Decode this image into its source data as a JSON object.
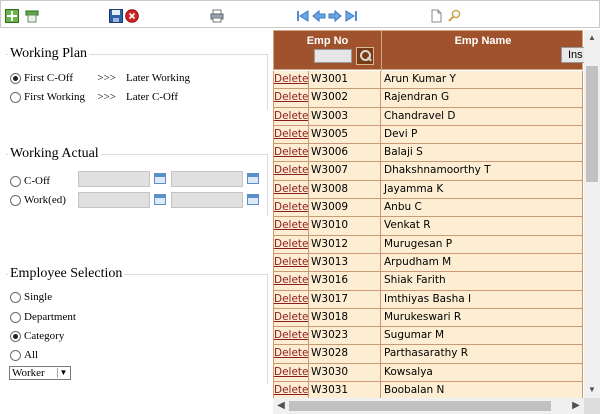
{
  "toolbar": {
    "icons": [
      "add-icon",
      "grid-icon",
      "save-icon",
      "delete-icon",
      "print-icon",
      "first-icon",
      "prev-icon",
      "next-icon",
      "last-icon",
      "new-document-icon",
      "search-icon"
    ]
  },
  "working_plan": {
    "legend": "Working Plan",
    "options": [
      {
        "left": "First C-Off",
        "sep": ">>>",
        "right": "Later Working",
        "selected": true
      },
      {
        "left": "First Working",
        "sep": ">>>",
        "right": "Later C-Off",
        "selected": false
      }
    ]
  },
  "working_actual": {
    "legend": "Working Actual",
    "options": [
      {
        "label": "C-Off",
        "selected": false
      },
      {
        "label": "Work(ed)",
        "selected": false
      }
    ]
  },
  "employee_selection": {
    "legend": "Employee Selection",
    "options": [
      {
        "label": "Single",
        "selected": false
      },
      {
        "label": "Department",
        "selected": false
      },
      {
        "label": "Category",
        "selected": true
      },
      {
        "label": "All",
        "selected": false
      }
    ],
    "category_select": {
      "value": "Worker"
    }
  },
  "grid": {
    "columns": {
      "emp_no": "Emp No",
      "emp_name": "Emp Name"
    },
    "insert_label": "Ins",
    "delete_label": "Delete",
    "rows": [
      {
        "emp_no": "W3001",
        "emp_name": "Arun Kumar Y"
      },
      {
        "emp_no": "W3002",
        "emp_name": "Rajendran G"
      },
      {
        "emp_no": "W3003",
        "emp_name": "Chandravel D"
      },
      {
        "emp_no": "W3005",
        "emp_name": "Devi P"
      },
      {
        "emp_no": "W3006",
        "emp_name": "Balaji S"
      },
      {
        "emp_no": "W3007",
        "emp_name": "Dhakshnamoorthy T"
      },
      {
        "emp_no": "W3008",
        "emp_name": "Jayamma K"
      },
      {
        "emp_no": "W3009",
        "emp_name": "Anbu C"
      },
      {
        "emp_no": "W3010",
        "emp_name": "Venkat R"
      },
      {
        "emp_no": "W3012",
        "emp_name": "Murugesan P"
      },
      {
        "emp_no": "W3013",
        "emp_name": "Arpudham M"
      },
      {
        "emp_no": "W3016",
        "emp_name": "Shiak Farith"
      },
      {
        "emp_no": "W3017",
        "emp_name": "Imthiyas Basha I"
      },
      {
        "emp_no": "W3018",
        "emp_name": "Murukeswari R"
      },
      {
        "emp_no": "W3023",
        "emp_name": "Sugumar M"
      },
      {
        "emp_no": "W3028",
        "emp_name": "Parthasarathy R"
      },
      {
        "emp_no": "W3030",
        "emp_name": "Kowsalya"
      },
      {
        "emp_no": "W3031",
        "emp_name": "Boobalan N"
      }
    ]
  }
}
